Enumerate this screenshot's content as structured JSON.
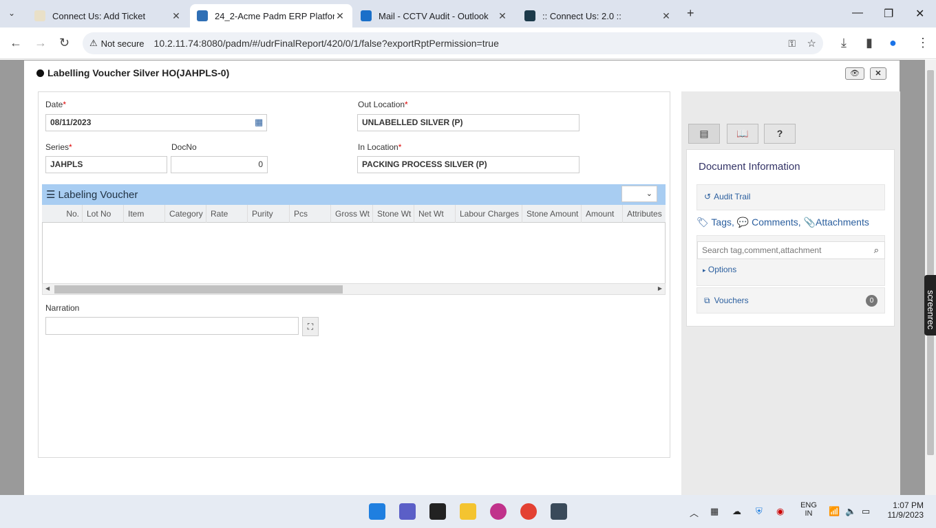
{
  "browser": {
    "tabs": [
      {
        "title": "Connect Us: Add Ticket",
        "fav_color": "#e9e0c8"
      },
      {
        "title": "24_2-Acme Padm ERP Platform",
        "fav_color": "#2f6fb5"
      },
      {
        "title": "Mail - CCTV Audit - Outlook",
        "fav_color": "#1a6fc9"
      },
      {
        "title": ":: Connect Us: 2.0 ::",
        "fav_color": "#1c3a4a"
      }
    ],
    "not_secure": "Not secure",
    "url": "10.2.11.74:8080/padm/#/udrFinalReport/420/0/1/false?exportRptPermission=true"
  },
  "modal": {
    "title": "Labelling Voucher Silver HO(JAHPLS-0)"
  },
  "form": {
    "date_label": "Date",
    "date_value": "08/11/2023",
    "series_label": "Series",
    "series_value": "JAHPLS",
    "docno_label": "DocNo",
    "docno_value": "0",
    "out_location_label": "Out Location",
    "out_location_value": "UNLABELLED SILVER (P)",
    "in_location_label": "In Location",
    "in_location_value": "PACKING PROCESS SILVER (P)",
    "narration_label": "Narration",
    "required_mark": "*"
  },
  "grid": {
    "title": "Labeling Voucher",
    "columns": [
      "No.",
      "Lot No",
      "Item",
      "Category",
      "Rate",
      "Purity",
      "Pcs",
      "Gross Wt",
      "Stone Wt",
      "Net Wt",
      "Labour Charges",
      "Stone Amount",
      "Amount",
      "Attributes"
    ]
  },
  "right_panel": {
    "doc_info": "Document Information",
    "audit_trail": "Audit Trail",
    "tags": "Tags,",
    "comments": "Comments,",
    "attachments": "Attachments",
    "search_placeholder": "Search tag,comment,attachment",
    "options": "Options",
    "vouchers": "Vouchers",
    "vouchers_count": "0"
  },
  "screenrec": "screenrec",
  "taskbar": {
    "lang_1": "ENG",
    "lang_2": "IN",
    "time": "1:07 PM",
    "date": "11/9/2023"
  }
}
